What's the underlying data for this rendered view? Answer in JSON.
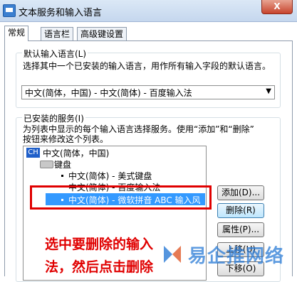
{
  "window": {
    "title": "文本服务和输入语言",
    "close_label": "X"
  },
  "tabs": [
    {
      "label": "常规"
    },
    {
      "label": "语言栏"
    },
    {
      "label": "高级键设置"
    }
  ],
  "default_input": {
    "group_label": "默认输入语言(L)",
    "description": "选择其中一个已安装的输入语言，用作所有输入字段的默认语言。",
    "selected": "中文(简体，中国) - 中文(简体) - 百度输入法",
    "arrow": "▼"
  },
  "installed": {
    "group_label": "已安装的服务(I)",
    "description_line1": "为列表中显示的每个输入语言选择服务。使用“添加”和“删除”",
    "description_line2": "按钮来修改这个列表。",
    "language_icon": "CH",
    "language": "中文(简体，中国)",
    "keyboard_label": "键盘",
    "items": [
      {
        "label": "中文(简体) - 美式键盘"
      },
      {
        "label": "中文(简体) - 百度输入法"
      },
      {
        "label": "中文(简体) - 微软拼音 ABC 输入风"
      }
    ]
  },
  "buttons": {
    "add": "添加(D)...",
    "remove": "删除(R)",
    "properties": "属性(P)...",
    "move_up": "上移(U)",
    "move_down": "下移(O)"
  },
  "annotation": {
    "line1": "选中要删除的输入",
    "line2": "法，然后点击删除"
  },
  "watermark": {
    "text": "易企推网络"
  },
  "colors": {
    "selection": "#3399ff",
    "annotation_red": "#e00000",
    "watermark_blue": "#2a7bd6"
  }
}
